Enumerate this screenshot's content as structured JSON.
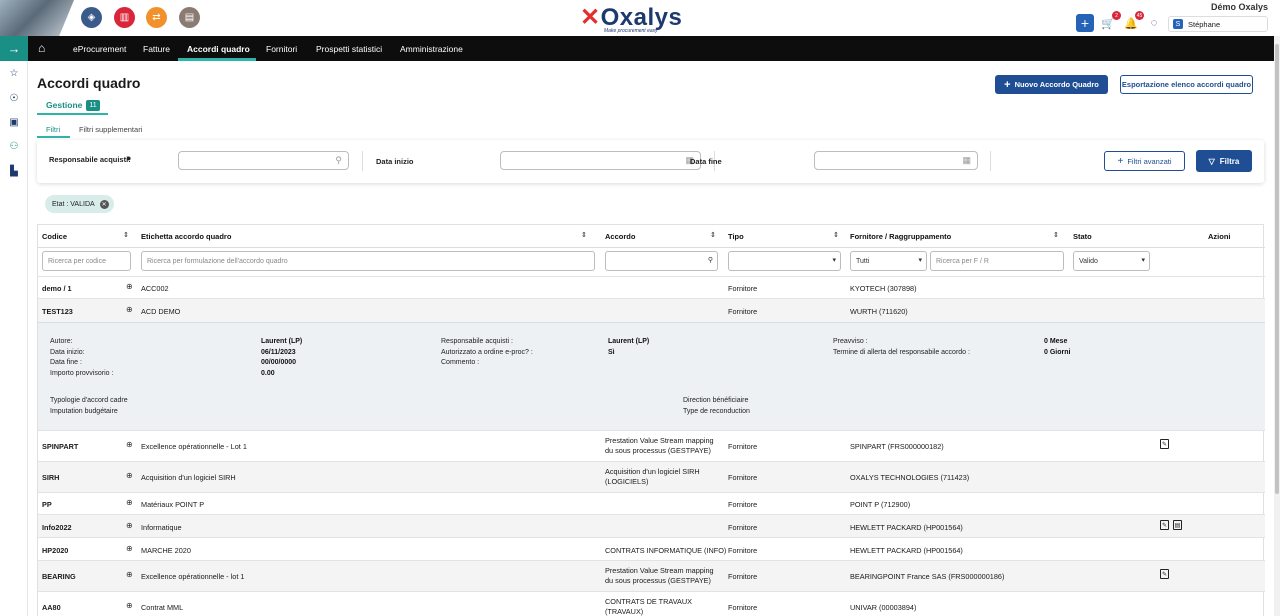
{
  "header": {
    "account": "Démo Oxalys",
    "user_initial": "S",
    "user_name": "Stéphane",
    "cart_count": "2",
    "notif_count": "45",
    "logo_o": "Oxalys",
    "logo_tag": "Make procurement easy"
  },
  "nav": {
    "items": [
      "eProcurement",
      "Fatture",
      "Accordi quadro",
      "Fornitori",
      "Prospetti statistici",
      "Amministrazione"
    ]
  },
  "page": {
    "title": "Accordi quadro",
    "tab_label": "Gestione",
    "tab_count": "11",
    "btn_new": "Nuovo Accordo Quadro",
    "btn_export": "Esportazione elenco accordi quadro",
    "filter_tab_1": "Filtri",
    "filter_tab_2": "Filtri supplementari"
  },
  "filters": {
    "responsabile_label": "Responsabile acquisti:",
    "data_inizio_label": "Data inizio",
    "data_fine_label": "Data fine",
    "btn_advanced": "Filtri avanzati",
    "btn_filter": "Filtra",
    "chip": "Etat : VALIDA"
  },
  "table": {
    "headers": [
      "Codice",
      "Etichetta accordo quadro",
      "Accordo",
      "Tipo",
      "Fornitore / Raggruppamento",
      "Stato",
      "Azioni"
    ],
    "search_codice": "Ricerca per codice",
    "search_etichetta": "Ricerca per formulazione dell'accordo quadro",
    "search_fornitore_select": "Tutti",
    "search_fornitore": "Ricerca per F / R",
    "search_stato": "Valido",
    "rows": [
      {
        "code": "demo / 1",
        "label": "ACC002",
        "accordo": "",
        "accordo2": "",
        "tipo": "Fornitore",
        "fornitore": "KYOTECH (307898)"
      },
      {
        "code": "TEST123",
        "label": "ACD DEMO",
        "accordo": "",
        "accordo2": "",
        "tipo": "Fornitore",
        "fornitore": "WURTH (711620)"
      },
      {
        "code": "SPINPART",
        "label": "Excellence opérationnelle - Lot 1",
        "accordo": "Prestation Value Stream mapping",
        "accordo2": "du sous processus (GESTPAYE)",
        "tipo": "Fornitore",
        "fornitore": "SPINPART (FRS000000182)"
      },
      {
        "code": "SIRH",
        "label": "Acquisition d'un logiciel SIRH",
        "accordo": "Acquisition d'un logiciel SIRH",
        "accordo2": "(LOGICIELS)",
        "tipo": "Fornitore",
        "fornitore": "OXALYS TECHNOLOGIES (711423)"
      },
      {
        "code": "PP",
        "label": "Matériaux POINT P",
        "accordo": "",
        "accordo2": "",
        "tipo": "Fornitore",
        "fornitore": "POINT P (712900)"
      },
      {
        "code": "Info2022",
        "label": "Informatique",
        "accordo": "",
        "accordo2": "",
        "tipo": "Fornitore",
        "fornitore": "HEWLETT PACKARD (HP001564)"
      },
      {
        "code": "HP2020",
        "label": "MARCHE 2020",
        "accordo": "CONTRATS INFORMATIQUE (INFO)",
        "accordo2": "",
        "tipo": "Fornitore",
        "fornitore": "HEWLETT PACKARD (HP001564)"
      },
      {
        "code": "BEARING",
        "label": "Excellence opérationnelle - lot 1",
        "accordo": "Prestation Value Stream mapping",
        "accordo2": "du sous processus (GESTPAYE)",
        "tipo": "Fornitore",
        "fornitore": "BEARINGPOINT France SAS (FRS000000186)"
      },
      {
        "code": "AA80",
        "label": "Contrat MML",
        "accordo": "CONTRATS DE TRAVAUX",
        "accordo2": "(TRAVAUX)",
        "tipo": "Fornitore",
        "fornitore": "UNIVAR (00003894)"
      }
    ],
    "detail": {
      "autore_label": "Autore:",
      "autore": "Laurent (LP)",
      "data_inizio_label": "Data inizio:",
      "data_inizio": "06/11/2023",
      "data_fine_label": "Data fine :",
      "data_fine": "00/00/0000",
      "importo_label": "Importo provvisorio :",
      "importo": "0.00",
      "resp_label": "Responsabile acquisti :",
      "resp": "Laurent (LP)",
      "autorizzato_label": "Autorizzato a ordine e-proc? :",
      "autorizzato": "Sì",
      "commento_label": "Commento :",
      "preavviso_label": "Preavviso :",
      "preavviso": "0 Mese",
      "termine_label": "Termine di allerta del responsabile accordo :",
      "termine": "0 Giorni",
      "typologie": "Typologie d'accord cadre",
      "imputation": "Imputation budgétaire",
      "direction": "Direction bénéficiaire",
      "reconduction": "Type de reconduction"
    }
  }
}
